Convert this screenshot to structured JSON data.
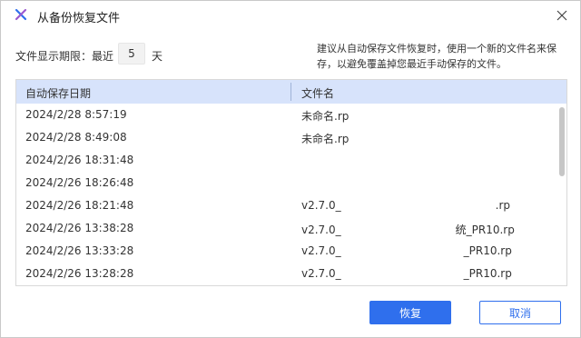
{
  "dialog": {
    "title": "从备份恢复文件",
    "icon": "axure-x-icon"
  },
  "period": {
    "label": "文件显示期限：最近",
    "value": "5",
    "unit": "天"
  },
  "hint": "建议从自动保存文件恢复时，使用一个新的文件名来保存，以避免覆盖掉您最近手动保存的文件。",
  "table": {
    "columns": [
      "自动保存日期",
      "文件名"
    ],
    "rows": [
      {
        "date": "2024/2/28 8:57:19",
        "name": "未命名.rp"
      },
      {
        "date": "2024/2/28 8:49:08",
        "name": "未命名.rp"
      },
      {
        "date": "2024/2/26 18:31:48",
        "name": ""
      },
      {
        "date": "2024/2/26 18:26:48",
        "name": ""
      },
      {
        "date": "2024/2/26 18:21:48",
        "name": "v2.7.0_",
        "suffix": ".rp"
      },
      {
        "date": "2024/2/26 13:38:28",
        "name": "v2.7.0_",
        "suffix": "统_PR10.rp"
      },
      {
        "date": "2024/2/26 13:33:28",
        "name": "v2.7.0_",
        "suffix": "_PR10.rp"
      },
      {
        "date": "2024/2/26 13:28:28",
        "name": "v2.7.0_",
        "suffix": "_PR10.rp"
      }
    ]
  },
  "buttons": {
    "restore": "恢复",
    "cancel": "取消"
  },
  "colors": {
    "accent": "#2f6fed",
    "header_bg": "#d7e3fb"
  }
}
